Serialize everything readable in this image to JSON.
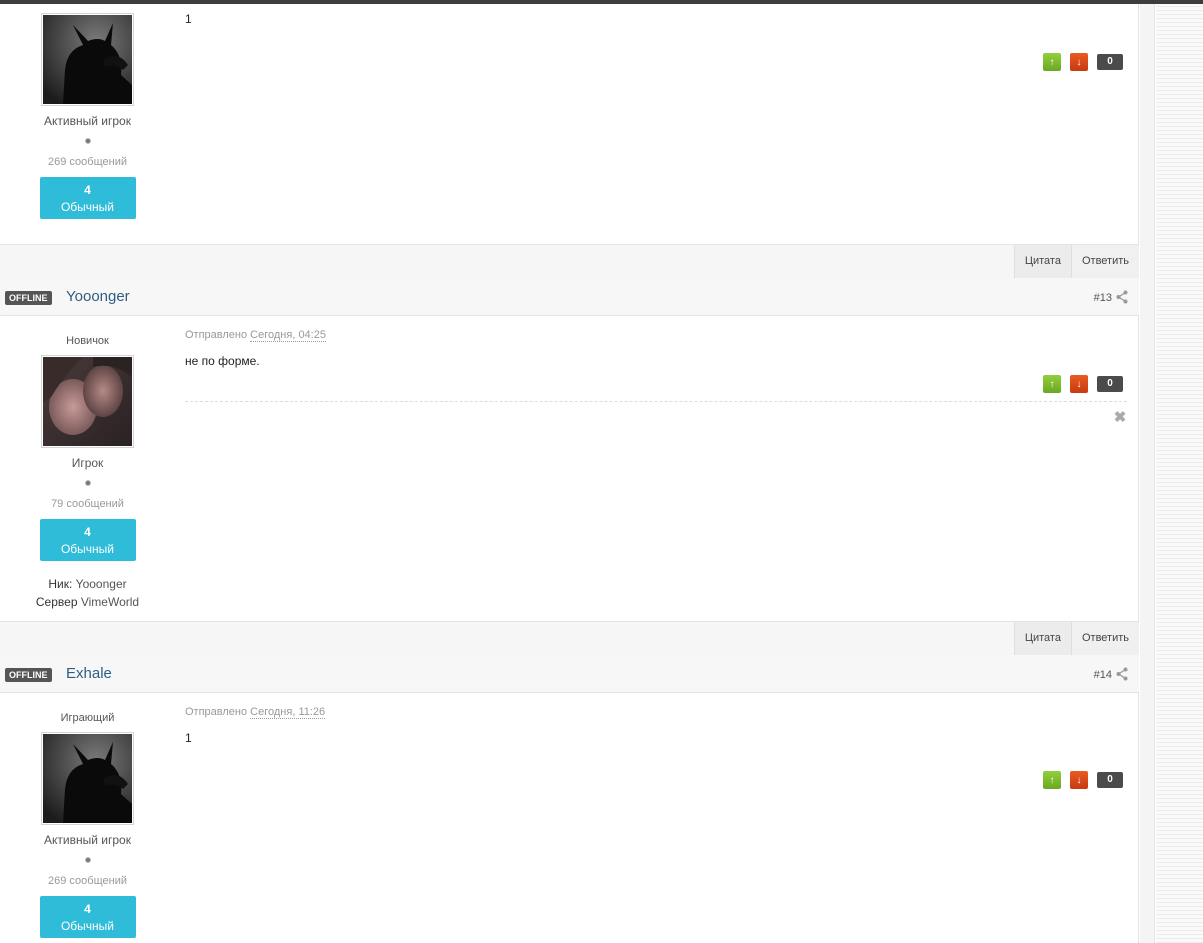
{
  "vote": {
    "up_glyph": "↑",
    "down_glyph": "↓",
    "remove_glyph": "✖"
  },
  "controls": {
    "quote_label": "Цитата",
    "reply_label": "Ответить"
  },
  "posts": [
    {
      "rank_title": "Активный игрок",
      "post_count": "269 сообщений",
      "rep_value": "4",
      "rep_label": "Обычный",
      "text": "1",
      "score": "0"
    },
    {
      "status": "OFFLINE",
      "author": "Yooonger",
      "number": "#13",
      "group_title": "Новичок",
      "rank_title": "Игрок",
      "post_count": "79 сообщений",
      "rep_value": "4",
      "rep_label": "Обычный",
      "nick_label": "Ник:",
      "nick_value": "Yooonger",
      "server_label": "Сервер",
      "server_value": "VimeWorld",
      "posted_label": "Отправлено",
      "posted_time": "Сегодня, 04:25",
      "text": "не по форме.",
      "score": "0"
    },
    {
      "status": "OFFLINE",
      "author": "Exhale",
      "number": "#14",
      "group_title": "Играющий",
      "rank_title": "Активный игрок",
      "post_count": "269 сообщений",
      "rep_value": "4",
      "rep_label": "Обычный",
      "posted_label": "Отправлено",
      "posted_time": "Сегодня, 11:26",
      "text": "1",
      "score": "0"
    }
  ]
}
